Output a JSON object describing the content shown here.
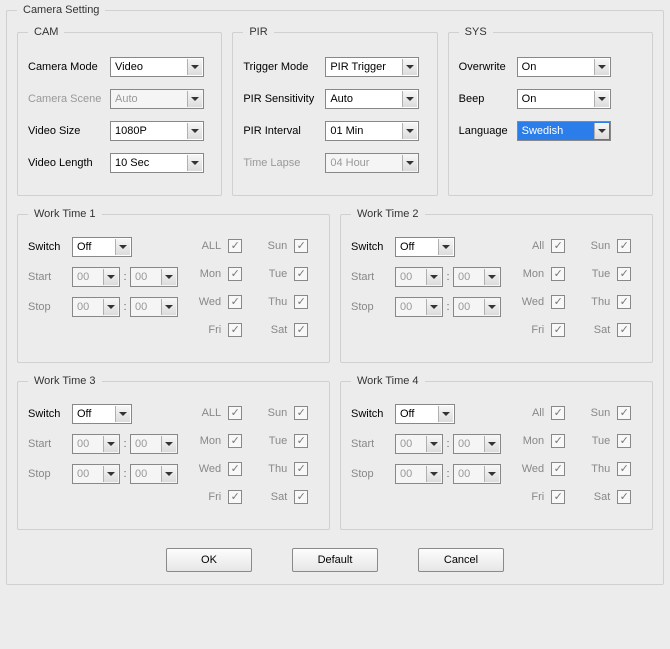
{
  "title": "Camera Setting",
  "cam": {
    "legend": "CAM",
    "cameraMode": {
      "label": "Camera Mode",
      "value": "Video"
    },
    "cameraScene": {
      "label": "Camera Scene",
      "value": "Auto",
      "disabled": true
    },
    "videoSize": {
      "label": "Video Size",
      "value": "1080P"
    },
    "videoLength": {
      "label": "Video Length",
      "value": "10 Sec"
    }
  },
  "pir": {
    "legend": "PIR",
    "triggerMode": {
      "label": "Trigger Mode",
      "value": "PIR Trigger"
    },
    "pirSensitivity": {
      "label": "PIR Sensitivity",
      "value": "Auto"
    },
    "pirInterval": {
      "label": "PIR Interval",
      "value": "01 Min"
    },
    "timeLapse": {
      "label": "Time Lapse",
      "value": "04 Hour",
      "disabled": true
    }
  },
  "sys": {
    "legend": "SYS",
    "overwrite": {
      "label": "Overwrite",
      "value": "On"
    },
    "beep": {
      "label": "Beep",
      "value": "On"
    },
    "language": {
      "label": "Language",
      "value": "Swedish",
      "highlighted": true
    }
  },
  "worktime": {
    "common": {
      "switchLabel": "Switch",
      "startLabel": "Start",
      "stopLabel": "Stop",
      "hour": "00",
      "min": "00"
    },
    "slots": [
      {
        "legend": "Work Time 1",
        "switch": "Off",
        "days": [
          {
            "name": "ALL",
            "checked": true
          },
          {
            "name": "Sun",
            "checked": true
          },
          {
            "name": "Mon",
            "checked": true
          },
          {
            "name": "Tue",
            "checked": true
          },
          {
            "name": "Wed",
            "checked": true
          },
          {
            "name": "Thu",
            "checked": true
          },
          {
            "name": "Fri",
            "checked": true
          },
          {
            "name": "Sat",
            "checked": true
          }
        ]
      },
      {
        "legend": "Work Time 2",
        "switch": "Off",
        "days": [
          {
            "name": "All",
            "checked": true
          },
          {
            "name": "Sun",
            "checked": true
          },
          {
            "name": "Mon",
            "checked": true
          },
          {
            "name": "Tue",
            "checked": true
          },
          {
            "name": "Wed",
            "checked": true
          },
          {
            "name": "Thu",
            "checked": true
          },
          {
            "name": "Fri",
            "checked": true
          },
          {
            "name": "Sat",
            "checked": true
          }
        ]
      },
      {
        "legend": "Work Time 3",
        "switch": "Off",
        "days": [
          {
            "name": "ALL",
            "checked": true
          },
          {
            "name": "Sun",
            "checked": true
          },
          {
            "name": "Mon",
            "checked": true
          },
          {
            "name": "Tue",
            "checked": true
          },
          {
            "name": "Wed",
            "checked": true
          },
          {
            "name": "Thu",
            "checked": true
          },
          {
            "name": "Fri",
            "checked": true
          },
          {
            "name": "Sat",
            "checked": true
          }
        ]
      },
      {
        "legend": "Work Time 4",
        "switch": "Off",
        "days": [
          {
            "name": "All",
            "checked": true
          },
          {
            "name": "Sun",
            "checked": true
          },
          {
            "name": "Mon",
            "checked": true
          },
          {
            "name": "Tue",
            "checked": true
          },
          {
            "name": "Wed",
            "checked": true
          },
          {
            "name": "Thu",
            "checked": true
          },
          {
            "name": "Fri",
            "checked": true
          },
          {
            "name": "Sat",
            "checked": true
          }
        ]
      }
    ]
  },
  "buttons": {
    "ok": "OK",
    "default": "Default",
    "cancel": "Cancel"
  }
}
